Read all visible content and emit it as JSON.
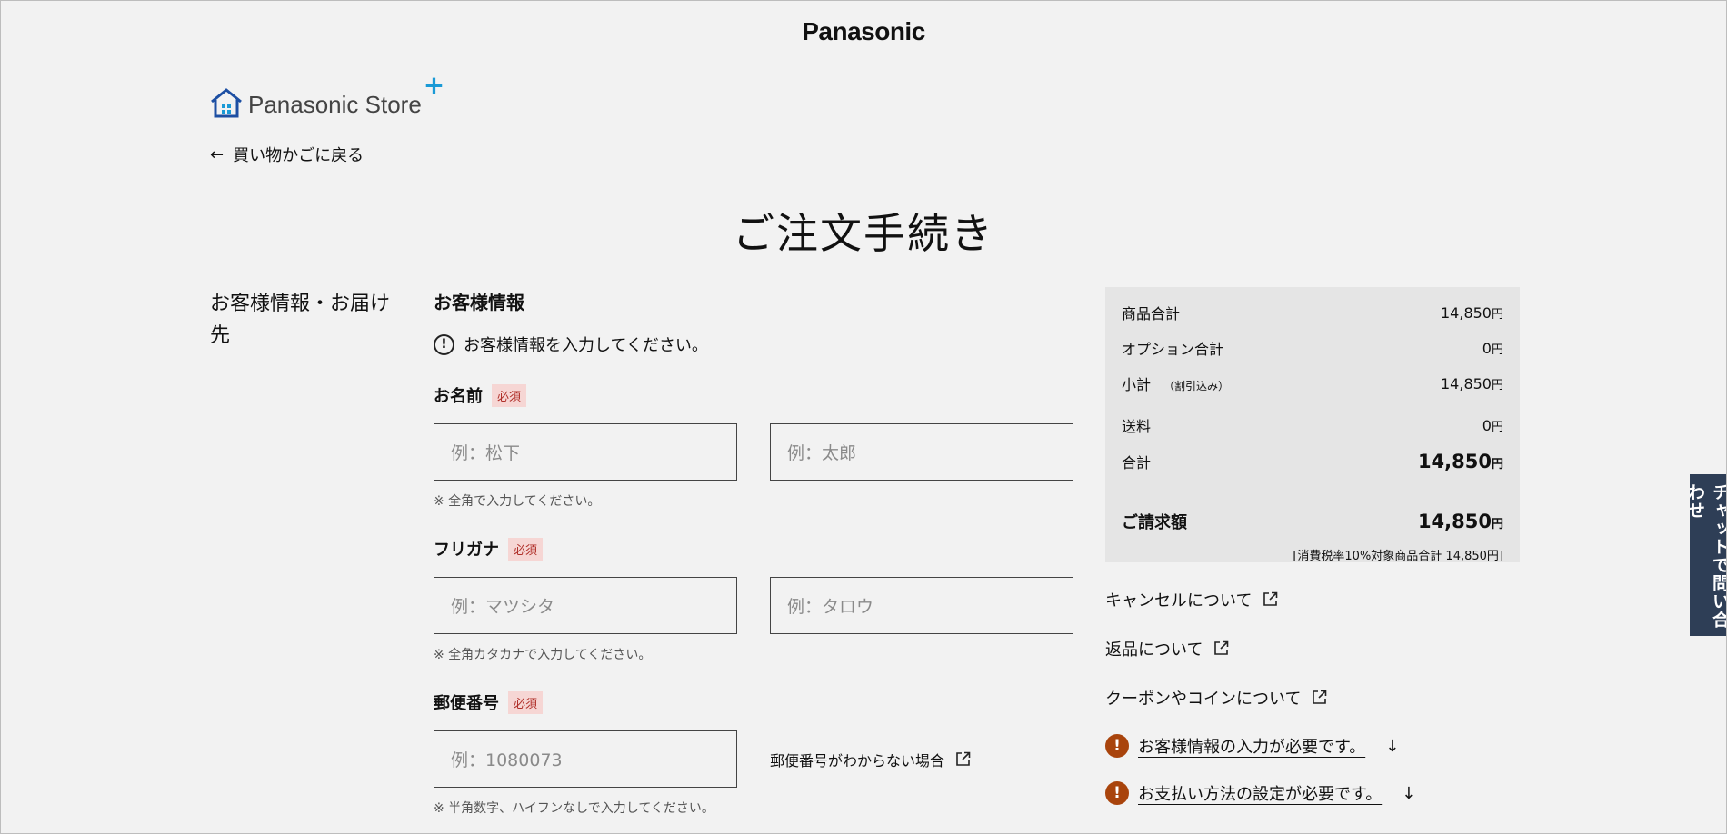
{
  "header": {
    "brand": "Panasonic"
  },
  "store": {
    "name": "Panasonic Store",
    "plus": "+"
  },
  "nav": {
    "back_label": "買い物かごに戻る"
  },
  "page": {
    "title": "ご注文手続き"
  },
  "steps": {
    "current": "お客様情報・お届け先"
  },
  "form": {
    "title": "お客様情報",
    "notice": "お客様情報を入力してください。",
    "required_badge": "必須",
    "name": {
      "label": "お名前",
      "last_placeholder": "例：松下",
      "first_placeholder": "例：太郎",
      "hint": "※ 全角で入力してください。"
    },
    "kana": {
      "label": "フリガナ",
      "last_placeholder": "例：マツシタ",
      "first_placeholder": "例：タロウ",
      "hint": "※ 全角カタカナで入力してください。"
    },
    "postal": {
      "label": "郵便番号",
      "placeholder": "例：1080073",
      "help_link": "郵便番号がわからない場合",
      "hint": "※ 半角数字、ハイフンなしで入力してください。"
    }
  },
  "summary": {
    "yen": "円",
    "product_total": {
      "label": "商品合計",
      "value": "14,850"
    },
    "option_total": {
      "label": "オプション合計",
      "value": "0"
    },
    "subtotal": {
      "label": "小計",
      "note": "（割引込み）",
      "value": "14,850"
    },
    "shipping": {
      "label": "送料",
      "value": "0"
    },
    "total": {
      "label": "合計",
      "value": "14,850"
    },
    "billing": {
      "label": "ご請求額",
      "value": "14,850"
    },
    "tax_note": "[消費税率10%対象商品合計 14,850円]"
  },
  "links": {
    "cancel": "キャンセルについて",
    "returns": "返品について",
    "coupons": "クーポンやコインについて"
  },
  "alerts": {
    "customer_info": "お客様情報の入力が必要です。",
    "payment": "お支払い方法の設定が必要です。"
  },
  "chat": {
    "label": "チャットで問い合わせ"
  }
}
